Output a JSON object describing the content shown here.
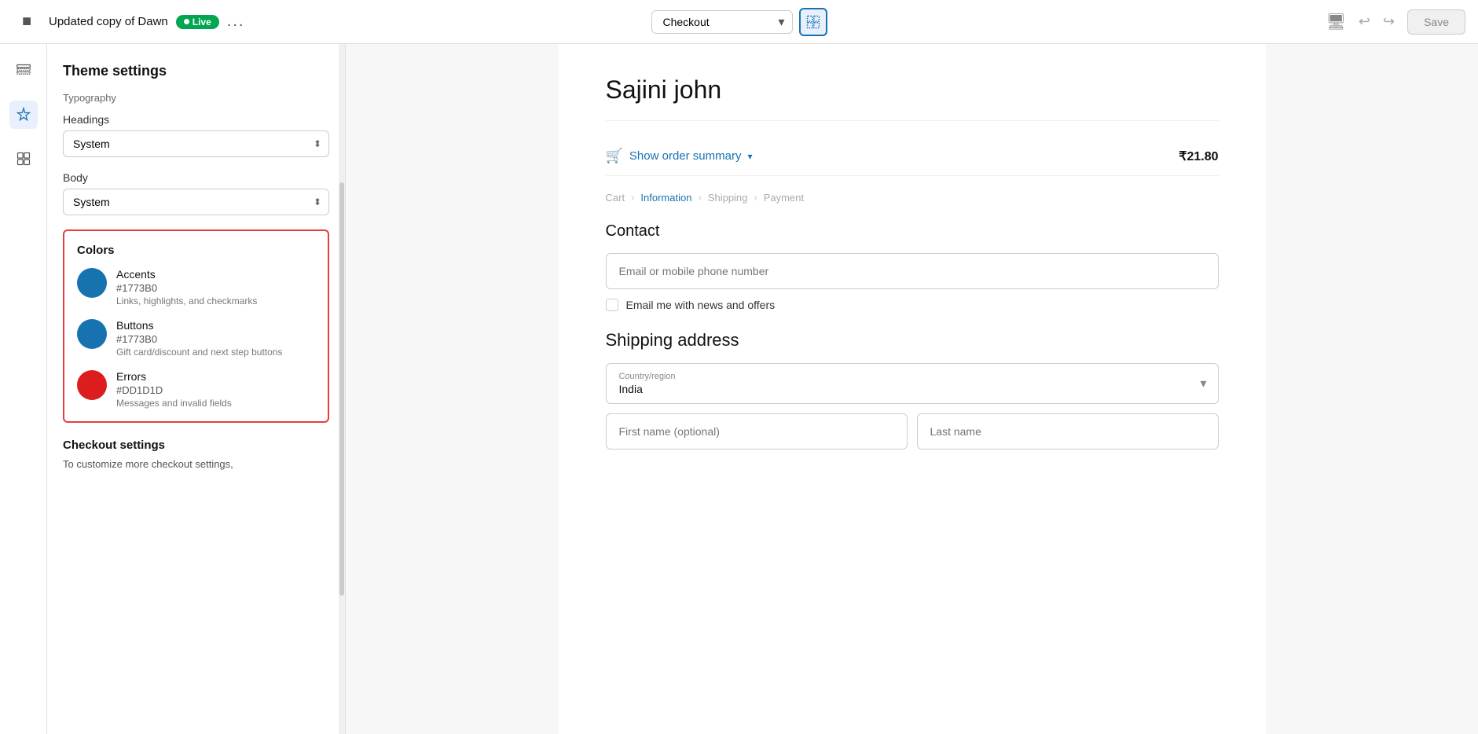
{
  "topbar": {
    "store_title": "Updated copy of Dawn",
    "live_label": "Live",
    "more_button": "...",
    "dropdown_value": "Checkout",
    "save_label": "Save",
    "undo_label": "↩",
    "redo_label": "↪"
  },
  "sidebar_icons": [
    {
      "name": "layout-icon",
      "symbol": "⊟",
      "active": false
    },
    {
      "name": "customize-icon",
      "symbol": "✦",
      "active": true
    },
    {
      "name": "sections-icon",
      "symbol": "⊞",
      "active": false
    }
  ],
  "settings_panel": {
    "title": "Theme settings",
    "typography_heading": "Typography",
    "headings_label": "Headings",
    "headings_value": "System",
    "body_label": "Body",
    "body_value": "System",
    "colors_title": "Colors",
    "colors": [
      {
        "name": "Accents",
        "hex": "#1773B0",
        "desc": "Links, highlights, and checkmarks",
        "swatch": "#1773B0"
      },
      {
        "name": "Buttons",
        "hex": "#1773B0",
        "desc": "Gift card/discount and next step buttons",
        "swatch": "#1773B0"
      },
      {
        "name": "Errors",
        "hex": "#DD1D1D",
        "desc": "Messages and invalid fields",
        "swatch": "#DD1D1D"
      }
    ],
    "checkout_settings_title": "Checkout settings",
    "checkout_settings_desc": "To customize more checkout settings,"
  },
  "preview": {
    "store_name": "Sajini john",
    "order_summary_label": "Show order summary",
    "order_price": "₹21.80",
    "breadcrumb": {
      "cart": "Cart",
      "information": "Information",
      "shipping": "Shipping",
      "payment": "Payment"
    },
    "contact_label": "Contact",
    "email_placeholder": "Email or mobile phone number",
    "newsletter_label": "Email me with news and offers",
    "shipping_label": "Shipping address",
    "country_label": "Country/region",
    "country_value": "India",
    "first_name_placeholder": "First name (optional)",
    "last_name_placeholder": "Last name"
  }
}
